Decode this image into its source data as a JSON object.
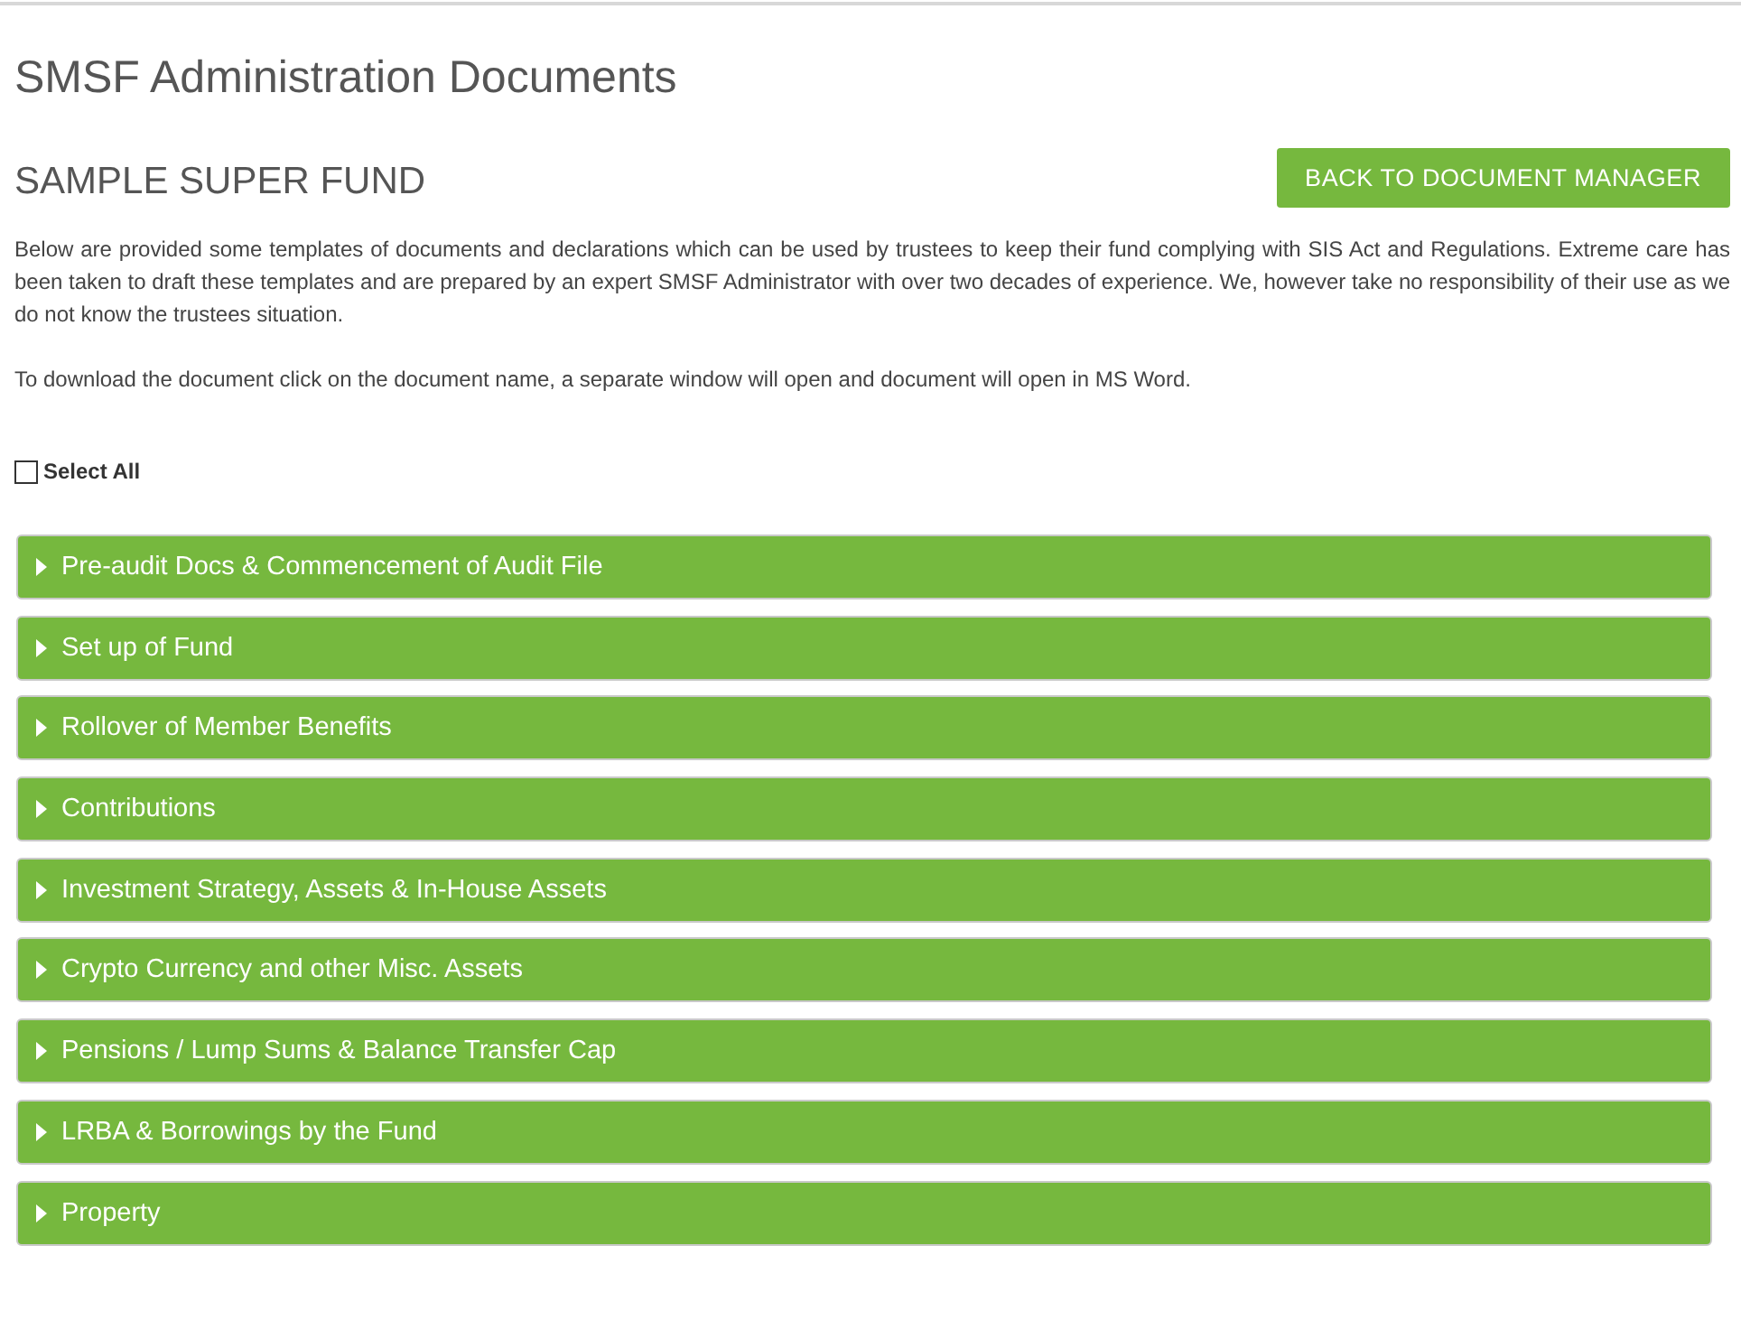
{
  "page": {
    "title": "SMSF Administration Documents"
  },
  "fund": {
    "name": "SAMPLE SUPER FUND",
    "back_button": "BACK TO DOCUMENT MANAGER"
  },
  "intro": [
    "Below are provided some templates of documents and declarations which can be used by trustees to keep their fund complying with SIS Act and Regulations. Extreme care has been taken to draft these templates and are prepared by an expert SMSF Administrator with over two decades of experience. We, however take no responsibility of their use as we do not know the trustees situation.",
    "To download the document click on the document name, a separate window will open and document will open in MS Word."
  ],
  "select_all": {
    "label": "Select All",
    "checked": false
  },
  "sections": [
    {
      "title": "Pre-audit Docs & Commencement of Audit File",
      "expanded": false
    },
    {
      "title": "Set up of Fund",
      "expanded": false
    },
    {
      "title": "Rollover of Member Benefits",
      "expanded": false
    },
    {
      "title": "Contributions",
      "expanded": false
    },
    {
      "title": "Investment Strategy, Assets & In-House Assets",
      "expanded": false
    },
    {
      "title": "Crypto Currency and other Misc. Assets",
      "expanded": false
    },
    {
      "title": "Pensions / Lump Sums & Balance Transfer Cap",
      "expanded": false
    },
    {
      "title": "LRBA & Borrowings by the Fund",
      "expanded": false
    },
    {
      "title": "Property",
      "expanded": false
    }
  ]
}
